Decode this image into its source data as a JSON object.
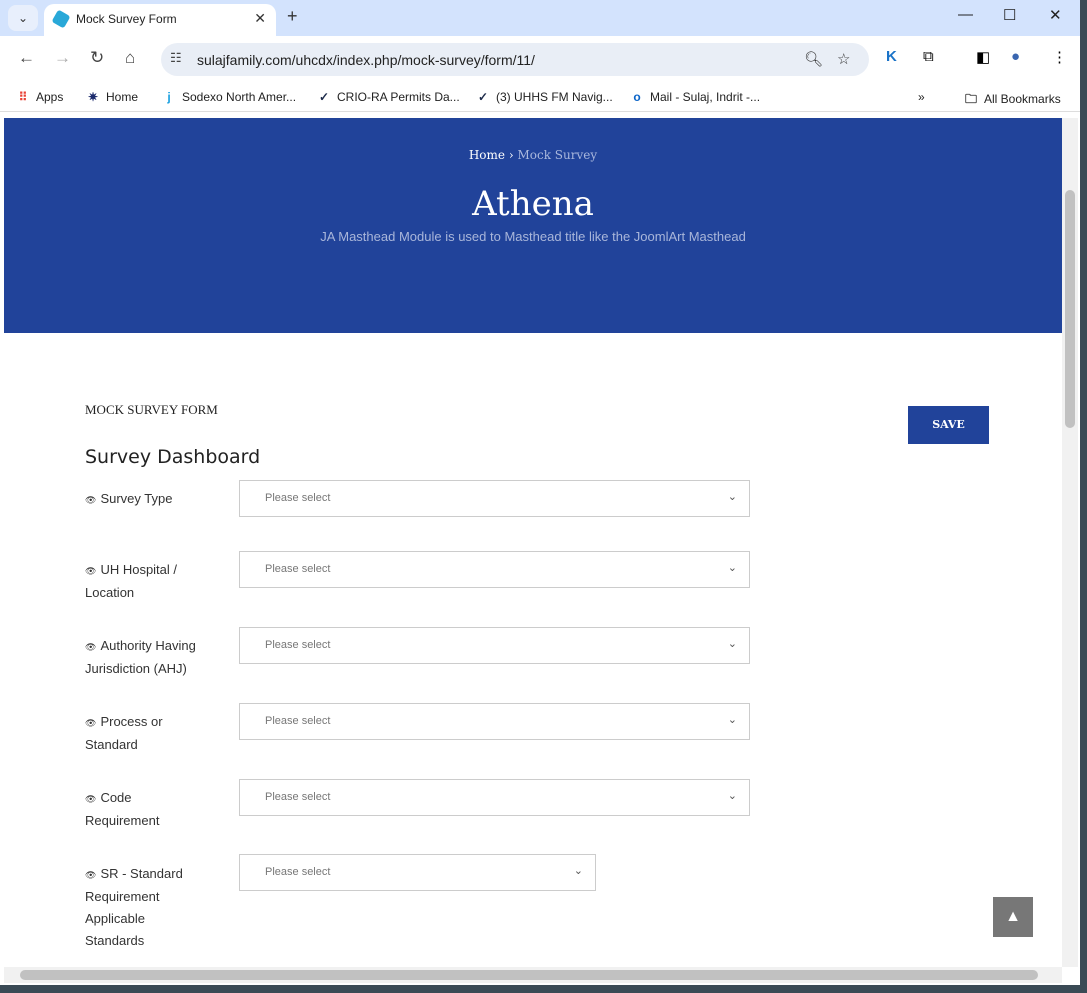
{
  "browser": {
    "tab_title": "Mock Survey Form",
    "url": "sulajfamily.com/uhcdx/index.php/mock-survey/form/11/",
    "bookmarks": [
      {
        "label": "Apps",
        "icon": "apps-grid-icon"
      },
      {
        "label": "Home",
        "icon": "star-icon"
      },
      {
        "label": "Sodexo North Amer...",
        "icon": "j-icon"
      },
      {
        "label": "CRIO-RA Permits Da...",
        "icon": "check-icon"
      },
      {
        "label": "(3) UHHS FM Navig...",
        "icon": "check-icon"
      },
      {
        "label": "Mail - Sulaj, Indrit -...",
        "icon": "outlook-icon"
      }
    ],
    "all_bookmarks": "All Bookmarks"
  },
  "masthead": {
    "breadcrumb": [
      "Home",
      "Mock Survey"
    ],
    "title": "Athena",
    "subtitle": "JA Masthead Module is used to Masthead title like the JoomlArt Masthead",
    "color": "#21439a"
  },
  "form": {
    "title": "MOCK SURVEY FORM",
    "save_label": "SAVE",
    "section": "Survey Dashboard",
    "fields": [
      {
        "label": "Survey Type",
        "placeholder": "Please select"
      },
      {
        "label": "UH Hospital / Location",
        "placeholder": "Please select"
      },
      {
        "label": "Authority Having Jurisdiction (AHJ)",
        "placeholder": "Please select"
      },
      {
        "label": "Process or Standard",
        "placeholder": "Please select"
      },
      {
        "label": "Code Requirement",
        "placeholder": "Please select"
      },
      {
        "label": "SR - Standard Requirement Applicable Standards",
        "placeholder": "Please select"
      }
    ]
  }
}
